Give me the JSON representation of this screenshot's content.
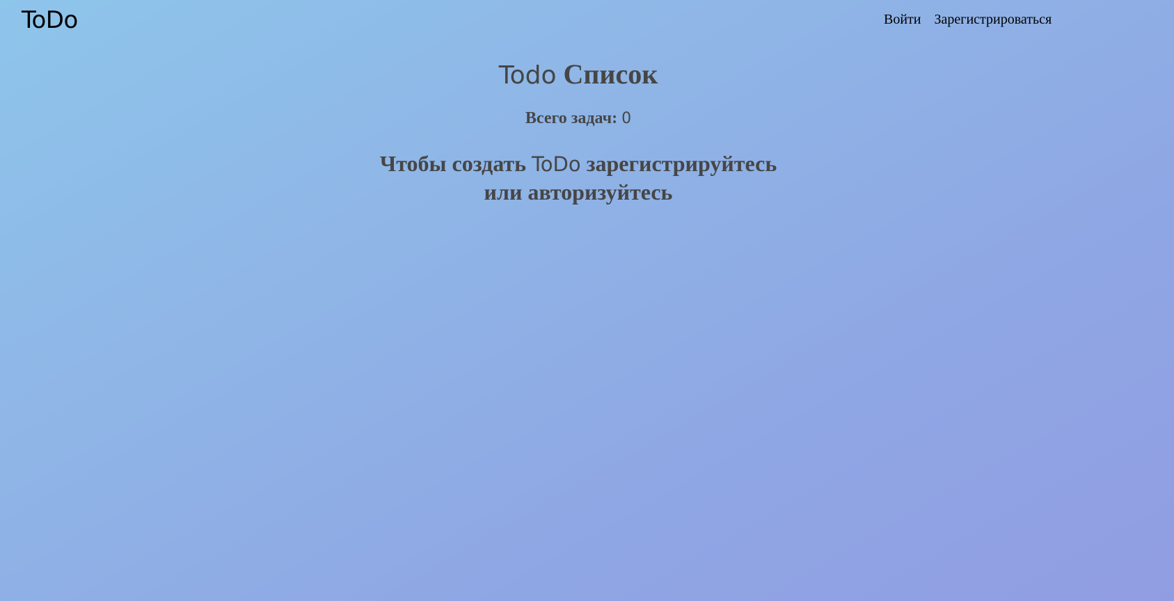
{
  "header": {
    "logo": "ToDo",
    "nav": {
      "login": "Войти",
      "register": "Зарегистрироваться"
    }
  },
  "main": {
    "title_prefix": "Todo",
    "title_suffix": " Список",
    "count_label": "Всего задач: ",
    "count_value": "0",
    "notice_line1_start": "Чтобы создать ",
    "notice_brand": "ToDo",
    "notice_line1_end": " зарегистрируйтесь",
    "notice_line2": "или авторизуйтесь"
  },
  "colors": {
    "gradient_start": "#8ec5eb",
    "gradient_end": "#919de2",
    "text": "#464646"
  }
}
